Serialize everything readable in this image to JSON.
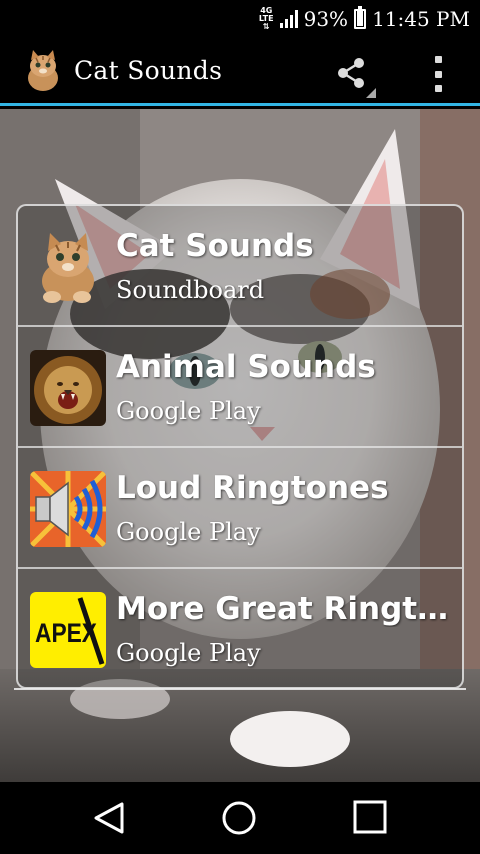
{
  "status_bar": {
    "network": "4G LTE",
    "battery_percent": "93%",
    "time": "11:45 PM"
  },
  "action_bar": {
    "title": "Cat Sounds",
    "icons": [
      "cat-app-icon",
      "share-icon",
      "overflow-menu-icon"
    ]
  },
  "list": {
    "items": [
      {
        "title": "Cat Sounds",
        "subtitle": "Soundboard",
        "icon": "kitten-icon"
      },
      {
        "title": "Animal Sounds",
        "subtitle": "Google Play",
        "icon": "lion-icon"
      },
      {
        "title": "Loud Ringtones",
        "subtitle": "Google Play",
        "icon": "speaker-icon"
      },
      {
        "title": "More Great Rington...",
        "subtitle": "Google Play",
        "icon": "apex-icon",
        "icon_text": "APEX"
      }
    ]
  },
  "nav_bar": {
    "buttons": [
      "back-icon",
      "home-icon",
      "recents-icon"
    ]
  },
  "colors": {
    "accent": "#33b5e5",
    "apex_yellow": "#ffee00"
  }
}
